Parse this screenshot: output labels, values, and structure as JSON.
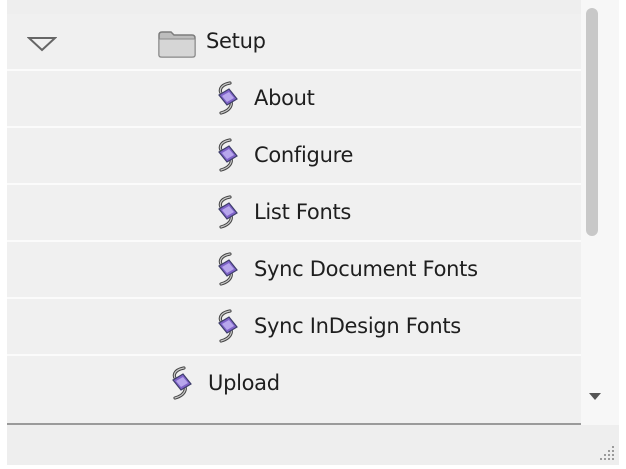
{
  "tree": {
    "folder": {
      "label": "Setup",
      "expanded": true,
      "icon": "folder-icon"
    },
    "children": [
      {
        "label": "About",
        "icon": "script-icon"
      },
      {
        "label": "Configure",
        "icon": "script-icon"
      },
      {
        "label": "List Fonts",
        "icon": "script-icon"
      },
      {
        "label": "Sync Document Fonts",
        "icon": "script-icon"
      },
      {
        "label": "Sync InDesign Fonts",
        "icon": "script-icon"
      }
    ],
    "after": [
      {
        "label": "Upload",
        "icon": "script-icon"
      }
    ]
  }
}
